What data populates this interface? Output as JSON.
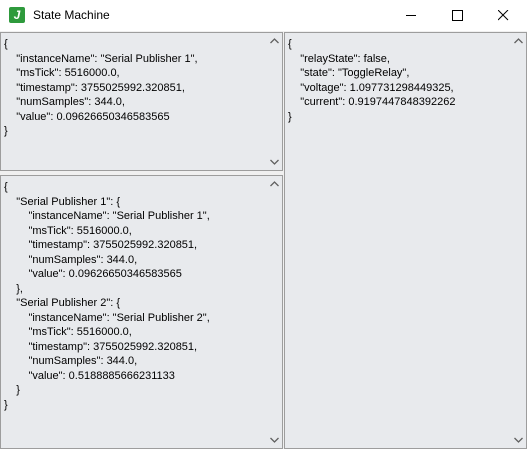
{
  "window": {
    "title": "State Machine",
    "icon_letter": "J",
    "icon_color": "#2e9a3c"
  },
  "panels": {
    "top_left": {
      "text": "{\n    \"instanceName\": \"Serial Publisher 1\",\n    \"msTick\": 5516000.0,\n    \"timestamp\": 3755025992.320851,\n    \"numSamples\": 344.0,\n    \"value\": 0.09626650346583565\n}"
    },
    "bottom_left": {
      "text": "{\n    \"Serial Publisher 1\": {\n        \"instanceName\": \"Serial Publisher 1\",\n        \"msTick\": 5516000.0,\n        \"timestamp\": 3755025992.320851,\n        \"numSamples\": 344.0,\n        \"value\": 0.09626650346583565\n    },\n    \"Serial Publisher 2\": {\n        \"instanceName\": \"Serial Publisher 2\",\n        \"msTick\": 5516000.0,\n        \"timestamp\": 3755025992.320851,\n        \"numSamples\": 344.0,\n        \"value\": 0.5188885666231133\n    }\n}"
    },
    "right": {
      "text": "{\n    \"relayState\": false,\n    \"state\": \"ToggleRelay\",\n    \"voltage\": 1.097731298449325,\n    \"current\": 0.9197447848392262\n}"
    }
  }
}
